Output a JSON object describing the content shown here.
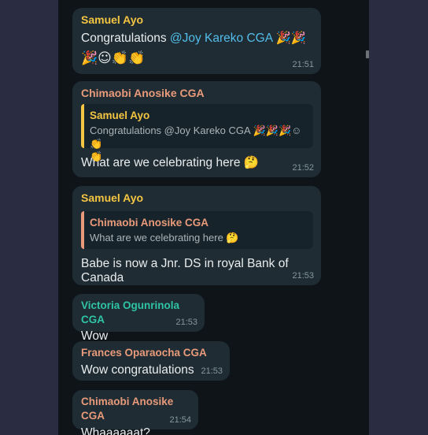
{
  "colors": {
    "samuel": "#f4c542",
    "chimaobi": "#e89a7a",
    "victoria": "#2fc4a6",
    "frances": "#e89a7a",
    "quote_bar_samuel": "#f4c542",
    "quote_bar_chimaobi": "#e89a7a"
  },
  "messages": [
    {
      "sender": "Samuel Ayo",
      "text_prefix": "Congratulations ",
      "mention": "@Joy Kareko CGA",
      "emojis_line1": "🎉🎉",
      "emojis_line2": "🎉☺👏👏",
      "time": "21:51"
    },
    {
      "sender": "Chimaobi Anosike CGA",
      "quote_sender": "Samuel Ayo",
      "quote_text": "Congratulations @Joy Kareko CGA 🎉🎉🎉☺👏",
      "quote_text2": "👏",
      "text": "What are we celebrating here 🤔",
      "time": "21:52"
    },
    {
      "sender": "Samuel Ayo",
      "quote_sender": "Chimaobi Anosike CGA",
      "quote_text": "What are we celebrating here 🤔",
      "text": "Babe is now a Jnr. DS in royal Bank of Canada",
      "time": "21:53"
    },
    {
      "sender": "Victoria Ogunrinola CGA",
      "text": "Wow",
      "time": "21:53"
    },
    {
      "sender": "Frances Oparaocha CGA",
      "text": "Wow congratulations",
      "time": "21:53"
    },
    {
      "sender": "Chimaobi Anosike CGA",
      "text": "Whaaaaaat?",
      "time": "21:54"
    }
  ]
}
